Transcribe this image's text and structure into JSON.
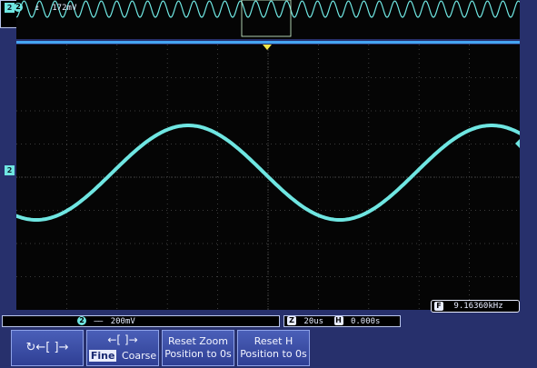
{
  "channel_marker": "2",
  "status": {
    "ch_scale": "200mV",
    "zoom_badge": "Z",
    "zoom_timebase": "20us",
    "hpos_badge": "H",
    "hpos_value": "0.000s",
    "trigger_level": "172mV",
    "frequency_badge": "F",
    "frequency": "9.16360kHz"
  },
  "softkeys": {
    "zoom_position_symbol": "↻←[ ]→",
    "fine_coarse_top_symbol": "←[ ]→",
    "fine": "Fine",
    "coarse": "Coarse",
    "reset_zoom_line1": "Reset Zoom",
    "reset_zoom_line2": "Position to 0s",
    "reset_h_line1": "Reset H",
    "reset_h_line2": "Position to 0s"
  },
  "colors": {
    "trace": "#6fe6e2",
    "screen_bg": "#050505",
    "bezel": "#27306c",
    "grid": "#4a4a4a",
    "separator": "#45a5f2"
  }
}
